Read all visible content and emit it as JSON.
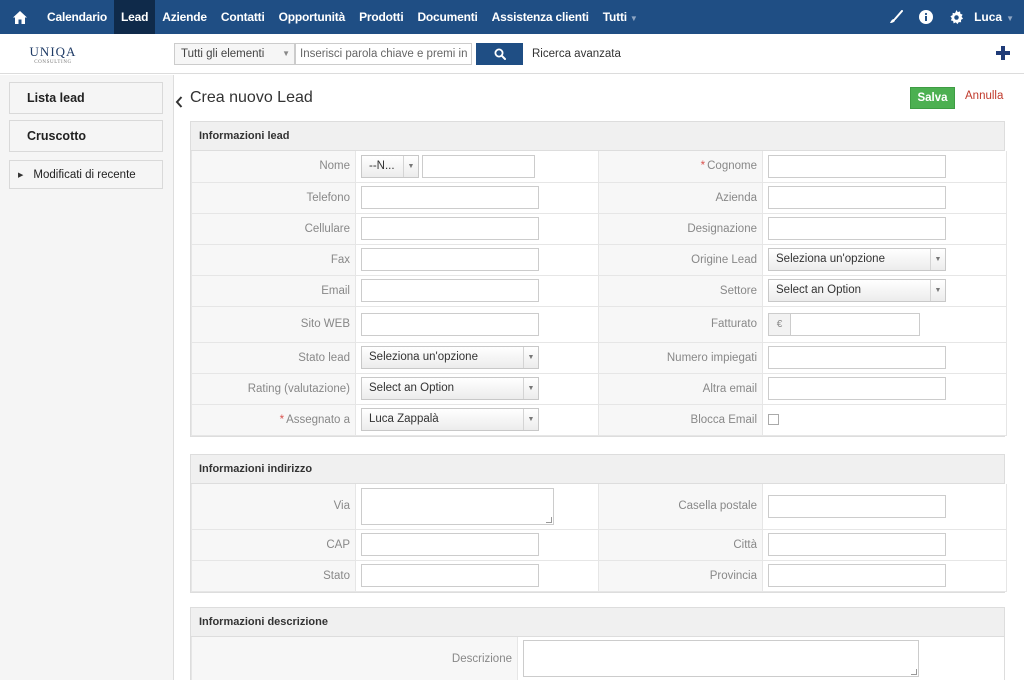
{
  "topnav": {
    "items": [
      {
        "label": "Calendario",
        "active": false
      },
      {
        "label": "Lead",
        "active": true
      },
      {
        "label": "Aziende",
        "active": false
      },
      {
        "label": "Contatti",
        "active": false
      },
      {
        "label": "Opportunità",
        "active": false
      },
      {
        "label": "Prodotti",
        "active": false
      },
      {
        "label": "Documenti",
        "active": false
      },
      {
        "label": "Assistenza clienti",
        "active": false
      },
      {
        "label": "Tutti",
        "active": false
      }
    ],
    "user": "Luca",
    "icons": [
      "home-icon",
      "brush-icon",
      "info-icon",
      "gear-icon",
      "chevron-down-icon"
    ],
    "color": "#1f4e84"
  },
  "logo": {
    "line1": "UNIQA",
    "line2": "CONSULTING"
  },
  "search": {
    "scope_value": "Tutti gli elementi",
    "placeholder": "Inserisci parola chiave e premi invio",
    "advanced_label": "Ricerca avanzata"
  },
  "sidebar": {
    "items": [
      "Lista lead",
      "Cruscotto"
    ],
    "recent_label": "Modificati di recente"
  },
  "main": {
    "title": "Crea nuovo Lead",
    "save_label": "Salva",
    "cancel_label": "Annulla"
  },
  "lead_block": {
    "title": "Informazioni lead",
    "salutation_value": "--N...",
    "currency_symbol": "€",
    "rows": [
      {
        "left": {
          "label": "Nome",
          "required": false
        },
        "right": {
          "label": "Cognome",
          "required": true
        }
      },
      {
        "left": {
          "label": "Telefono",
          "required": false
        },
        "right": {
          "label": "Azienda",
          "required": false
        }
      },
      {
        "left": {
          "label": "Cellulare",
          "required": false
        },
        "right": {
          "label": "Designazione",
          "required": false
        }
      },
      {
        "left": {
          "label": "Fax",
          "required": false
        },
        "right": {
          "label": "Origine Lead",
          "required": false,
          "value": "Seleziona un'opzione"
        }
      },
      {
        "left": {
          "label": "Email",
          "required": false
        },
        "right": {
          "label": "Settore",
          "required": false,
          "value": "Select an Option"
        }
      },
      {
        "left": {
          "label": "Sito WEB",
          "required": false
        },
        "right": {
          "label": "Fatturato",
          "required": false
        }
      },
      {
        "left": {
          "label": "Stato lead",
          "required": false,
          "value": "Seleziona un'opzione"
        },
        "right": {
          "label": "Numero impiegati",
          "required": false
        }
      },
      {
        "left": {
          "label": "Rating (valutazione)",
          "required": false,
          "value": "Select an Option"
        },
        "right": {
          "label": "Altra email",
          "required": false
        }
      },
      {
        "left": {
          "label": "Assegnato a",
          "required": true,
          "value": "Luca Zappalà"
        },
        "right": {
          "label": "Blocca Email",
          "required": false,
          "checked": false
        }
      }
    ]
  },
  "address_block": {
    "title": "Informazioni indirizzo",
    "rows": [
      {
        "left": {
          "label": "Via"
        },
        "right": {
          "label": "Casella postale"
        }
      },
      {
        "left": {
          "label": "CAP"
        },
        "right": {
          "label": "Città"
        }
      },
      {
        "left": {
          "label": "Stato"
        },
        "right": {
          "label": "Provincia"
        }
      }
    ]
  },
  "description_block": {
    "title": "Informazioni descrizione",
    "rows": [
      {
        "label": "Descrizione"
      }
    ]
  }
}
